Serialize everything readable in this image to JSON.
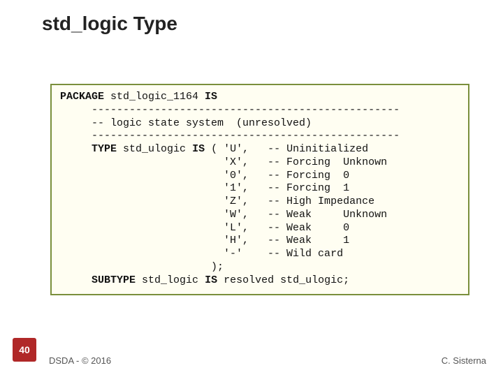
{
  "title": "std_logic Type",
  "code": {
    "l1a": "PACKAGE",
    "l1b": " std_logic_1164 ",
    "l1c": "IS",
    "l2": "     -------------------------------------------------",
    "l3": "     -- logic state system  (unresolved)",
    "l4": "     -------------------------------------------------",
    "l5a": "     ",
    "l5b": "TYPE",
    "l5c": " std_ulogic ",
    "l5d": "IS",
    "l5e": " ( 'U',   -- Uninitialized",
    "l6": "                          'X',   -- Forcing  Unknown",
    "l7": "                          '0',   -- Forcing  0",
    "l8": "                          '1',   -- Forcing  1",
    "l9": "                          'Z',   -- High Impedance",
    "l10": "                          'W',   -- Weak     Unknown",
    "l11": "                          'L',   -- Weak     0",
    "l12": "                          'H',   -- Weak     1",
    "l13": "                          '-'    -- Wild card",
    "l14": "                        );",
    "l15a": "     ",
    "l15b": "SUBTYPE",
    "l15c": " std_logic ",
    "l15d": "IS",
    "l15e": " resolved std_ulogic;"
  },
  "page_number": "40",
  "footer_left": "DSDA - © 2016",
  "footer_right": "C. Sisterna"
}
